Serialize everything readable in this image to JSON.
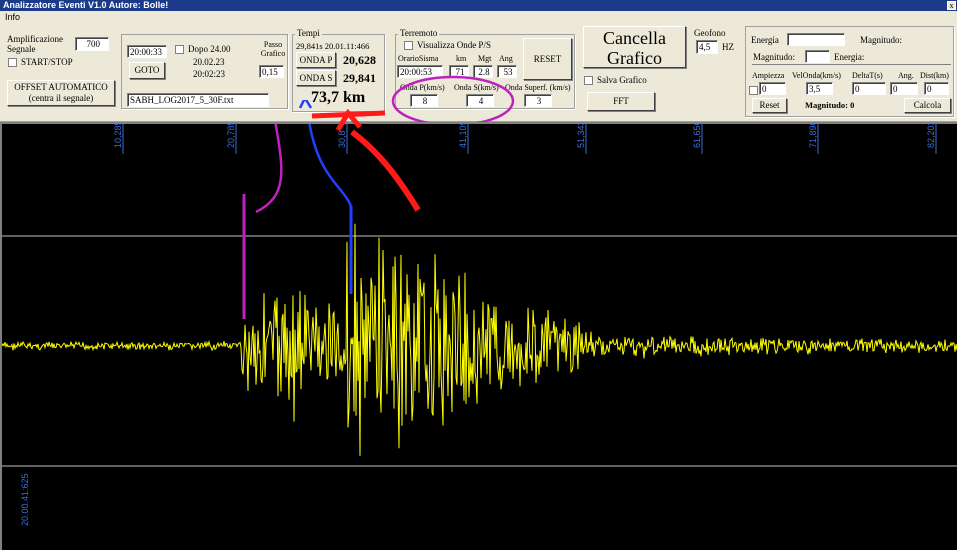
{
  "window": {
    "title": "Analizzatore Eventi V1.0  Autore: Bolle!",
    "close_label": "x"
  },
  "menu": {
    "items": [
      "Info"
    ]
  },
  "amplification": {
    "label": "Amplificazione Segnale",
    "value": "700",
    "startstop_label": "START/STOP",
    "offset_button": "OFFSET AUTOMATICO (centra il segnale)"
  },
  "time_nav": {
    "time_value": "20:00:33",
    "dopo_label": "Dopo 24.00",
    "time1": "20.02.23",
    "time2": "20:02:23",
    "goto_button": "GOTO",
    "passo_label": "Passo Grafico",
    "passo_value": "0,15",
    "file_value": "SABH_LOG2017_5_30F.txt"
  },
  "tempi": {
    "title": "Tempi",
    "info": "29,841s 20.01.11:466",
    "onda_p_button": "ONDA P",
    "onda_p_value": "20,628",
    "onda_s_button": "ONDA S",
    "onda_s_value": "29,841",
    "distance": "73,7 km"
  },
  "terremoto": {
    "title": "Terremoto",
    "visualizza_label": "Visualizza Onde P/S",
    "headers": [
      "OrarioSisma",
      "km",
      "Mgt",
      "Ang"
    ],
    "values": [
      "20:00:53",
      "71",
      "2.8",
      "53"
    ],
    "reset_button": "RESET",
    "onda_p_label": "Onda P(km/s)",
    "onda_s_label": "Onda S(km/s)",
    "onda_superf_label": "Onda Superf. (km/s)",
    "onda_p": "8",
    "onda_s": "4",
    "onda_superf": "3"
  },
  "grafico": {
    "cancella_button": "Cancella Grafico",
    "salva_label": "Salva Grafico",
    "fft_button": "FFT"
  },
  "geofono": {
    "label": "Geofono",
    "value": "4,5",
    "unit": "HZ"
  },
  "energia": {
    "energia_label": "Energia",
    "magnitudo_label": "Magnitudo:",
    "magnitudo2_label": "Magnitudo:",
    "energia2_label": "Energia:",
    "headers": [
      "Ampiezza",
      "VelOnda(km/s)",
      "DeltaT(s)",
      "Ang.",
      "Dist(km)"
    ],
    "values": [
      "0",
      "3,5",
      "0",
      "0",
      "0"
    ],
    "reset_button": "Reset",
    "magnitudo_result": "Magnitudo: 0",
    "calcola_button": "Calcola"
  },
  "plot": {
    "time_ticks": [
      "10,285s",
      "20,785s",
      "30,8",
      "41,109s",
      "51,343s",
      "61,656s",
      "71,890s",
      "82,203s"
    ],
    "left_label": "20.00.41:625"
  },
  "colors": {
    "signal": "#ffff00",
    "tick": "#3a6bd8",
    "annotation_red": "#ff1a1a",
    "annotation_magenta": "#c020c0",
    "annotation_blue": "#2040ff"
  }
}
